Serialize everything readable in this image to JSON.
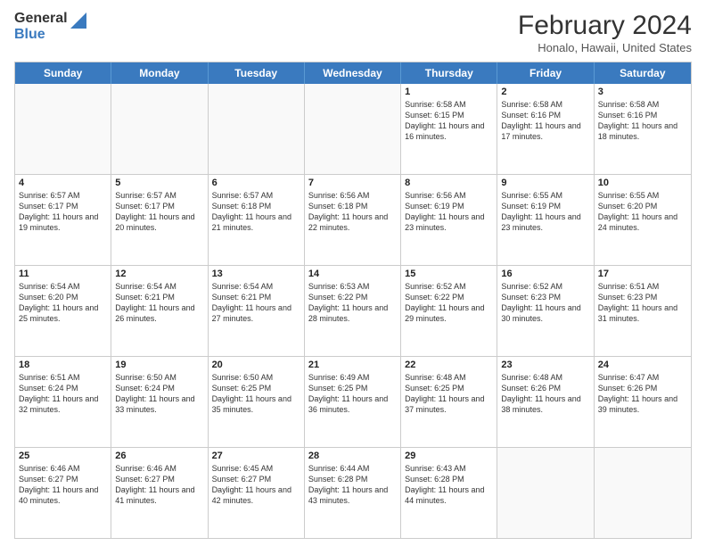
{
  "logo": {
    "line1": "General",
    "line2": "Blue"
  },
  "header": {
    "month_year": "February 2024",
    "location": "Honalo, Hawaii, United States"
  },
  "days_of_week": [
    "Sunday",
    "Monday",
    "Tuesday",
    "Wednesday",
    "Thursday",
    "Friday",
    "Saturday"
  ],
  "weeks": [
    [
      {
        "day": "",
        "info": ""
      },
      {
        "day": "",
        "info": ""
      },
      {
        "day": "",
        "info": ""
      },
      {
        "day": "",
        "info": ""
      },
      {
        "day": "1",
        "info": "Sunrise: 6:58 AM\nSunset: 6:15 PM\nDaylight: 11 hours and 16 minutes."
      },
      {
        "day": "2",
        "info": "Sunrise: 6:58 AM\nSunset: 6:16 PM\nDaylight: 11 hours and 17 minutes."
      },
      {
        "day": "3",
        "info": "Sunrise: 6:58 AM\nSunset: 6:16 PM\nDaylight: 11 hours and 18 minutes."
      }
    ],
    [
      {
        "day": "4",
        "info": "Sunrise: 6:57 AM\nSunset: 6:17 PM\nDaylight: 11 hours and 19 minutes."
      },
      {
        "day": "5",
        "info": "Sunrise: 6:57 AM\nSunset: 6:17 PM\nDaylight: 11 hours and 20 minutes."
      },
      {
        "day": "6",
        "info": "Sunrise: 6:57 AM\nSunset: 6:18 PM\nDaylight: 11 hours and 21 minutes."
      },
      {
        "day": "7",
        "info": "Sunrise: 6:56 AM\nSunset: 6:18 PM\nDaylight: 11 hours and 22 minutes."
      },
      {
        "day": "8",
        "info": "Sunrise: 6:56 AM\nSunset: 6:19 PM\nDaylight: 11 hours and 23 minutes."
      },
      {
        "day": "9",
        "info": "Sunrise: 6:55 AM\nSunset: 6:19 PM\nDaylight: 11 hours and 23 minutes."
      },
      {
        "day": "10",
        "info": "Sunrise: 6:55 AM\nSunset: 6:20 PM\nDaylight: 11 hours and 24 minutes."
      }
    ],
    [
      {
        "day": "11",
        "info": "Sunrise: 6:54 AM\nSunset: 6:20 PM\nDaylight: 11 hours and 25 minutes."
      },
      {
        "day": "12",
        "info": "Sunrise: 6:54 AM\nSunset: 6:21 PM\nDaylight: 11 hours and 26 minutes."
      },
      {
        "day": "13",
        "info": "Sunrise: 6:54 AM\nSunset: 6:21 PM\nDaylight: 11 hours and 27 minutes."
      },
      {
        "day": "14",
        "info": "Sunrise: 6:53 AM\nSunset: 6:22 PM\nDaylight: 11 hours and 28 minutes."
      },
      {
        "day": "15",
        "info": "Sunrise: 6:52 AM\nSunset: 6:22 PM\nDaylight: 11 hours and 29 minutes."
      },
      {
        "day": "16",
        "info": "Sunrise: 6:52 AM\nSunset: 6:23 PM\nDaylight: 11 hours and 30 minutes."
      },
      {
        "day": "17",
        "info": "Sunrise: 6:51 AM\nSunset: 6:23 PM\nDaylight: 11 hours and 31 minutes."
      }
    ],
    [
      {
        "day": "18",
        "info": "Sunrise: 6:51 AM\nSunset: 6:24 PM\nDaylight: 11 hours and 32 minutes."
      },
      {
        "day": "19",
        "info": "Sunrise: 6:50 AM\nSunset: 6:24 PM\nDaylight: 11 hours and 33 minutes."
      },
      {
        "day": "20",
        "info": "Sunrise: 6:50 AM\nSunset: 6:25 PM\nDaylight: 11 hours and 35 minutes."
      },
      {
        "day": "21",
        "info": "Sunrise: 6:49 AM\nSunset: 6:25 PM\nDaylight: 11 hours and 36 minutes."
      },
      {
        "day": "22",
        "info": "Sunrise: 6:48 AM\nSunset: 6:25 PM\nDaylight: 11 hours and 37 minutes."
      },
      {
        "day": "23",
        "info": "Sunrise: 6:48 AM\nSunset: 6:26 PM\nDaylight: 11 hours and 38 minutes."
      },
      {
        "day": "24",
        "info": "Sunrise: 6:47 AM\nSunset: 6:26 PM\nDaylight: 11 hours and 39 minutes."
      }
    ],
    [
      {
        "day": "25",
        "info": "Sunrise: 6:46 AM\nSunset: 6:27 PM\nDaylight: 11 hours and 40 minutes."
      },
      {
        "day": "26",
        "info": "Sunrise: 6:46 AM\nSunset: 6:27 PM\nDaylight: 11 hours and 41 minutes."
      },
      {
        "day": "27",
        "info": "Sunrise: 6:45 AM\nSunset: 6:27 PM\nDaylight: 11 hours and 42 minutes."
      },
      {
        "day": "28",
        "info": "Sunrise: 6:44 AM\nSunset: 6:28 PM\nDaylight: 11 hours and 43 minutes."
      },
      {
        "day": "29",
        "info": "Sunrise: 6:43 AM\nSunset: 6:28 PM\nDaylight: 11 hours and 44 minutes."
      },
      {
        "day": "",
        "info": ""
      },
      {
        "day": "",
        "info": ""
      }
    ]
  ]
}
